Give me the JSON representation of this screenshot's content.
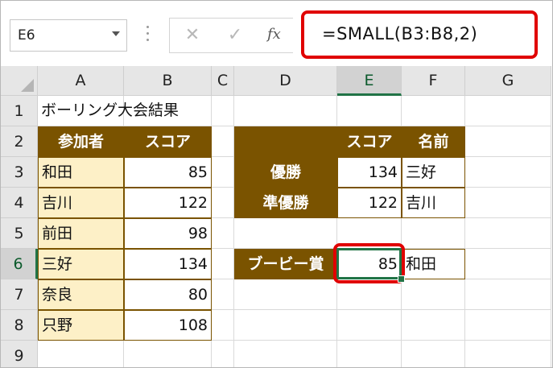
{
  "name_box": {
    "value": "E6"
  },
  "formula_bar": {
    "cancel_glyph": "✕",
    "enter_glyph": "✓",
    "fx_label": "fx",
    "formula": "=SMALL(B3:B8,2)"
  },
  "columns": [
    "A",
    "B",
    "C",
    "D",
    "E",
    "F",
    "G"
  ],
  "rows": [
    "1",
    "2",
    "3",
    "4",
    "5",
    "6",
    "7",
    "8",
    "9"
  ],
  "sheet": {
    "title": "ボーリング大会結果",
    "players_table": {
      "headers": [
        "参加者",
        "スコア"
      ],
      "rows": [
        [
          "和田",
          "85"
        ],
        [
          "吉川",
          "122"
        ],
        [
          "前田",
          "98"
        ],
        [
          "三好",
          "134"
        ],
        [
          "奈良",
          "80"
        ],
        [
          "只野",
          "108"
        ]
      ]
    },
    "results_table": {
      "headers": [
        "",
        "スコア",
        "名前"
      ],
      "rows": [
        [
          "優勝",
          "134",
          "三好"
        ],
        [
          "準優勝",
          "122",
          "吉川"
        ]
      ]
    },
    "booby": {
      "label": "ブービー賞",
      "score": "85",
      "name": "和田"
    }
  },
  "colors": {
    "header_brown": "#7a5300",
    "cream_fill": "#fdf0c7",
    "highlight_red": "#e00000",
    "excel_green": "#217346"
  }
}
